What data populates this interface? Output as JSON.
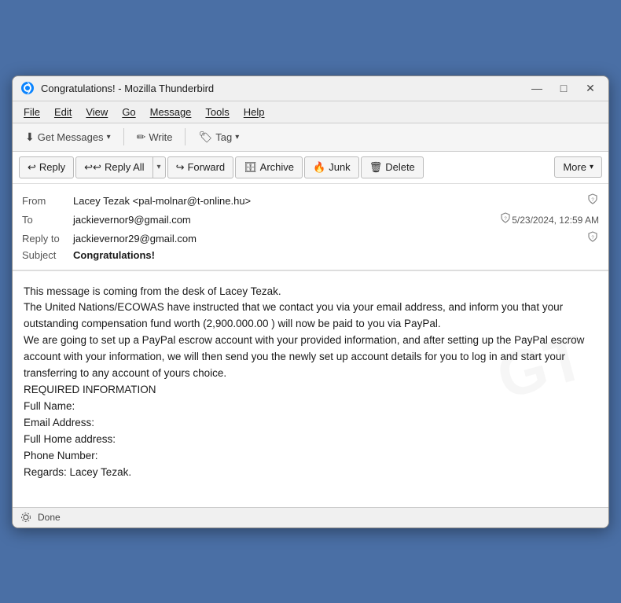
{
  "window": {
    "title": "Congratulations! - Mozilla Thunderbird",
    "icon": "thunderbird"
  },
  "title_controls": {
    "minimize": "—",
    "maximize": "□",
    "close": "✕"
  },
  "menu": {
    "items": [
      "File",
      "Edit",
      "View",
      "Go",
      "Message",
      "Tools",
      "Help"
    ]
  },
  "toolbar": {
    "get_messages": "Get Messages",
    "write": "Write",
    "tag": "Tag"
  },
  "actions": {
    "reply": "Reply",
    "reply_all": "Reply All",
    "forward": "Forward",
    "archive": "Archive",
    "junk": "Junk",
    "delete": "Delete",
    "more": "More"
  },
  "email": {
    "from_label": "From",
    "from_value": "Lacey Tezak <pal-molnar@t-online.hu>",
    "to_label": "To",
    "to_value": "jackievernor9@gmail.com",
    "date": "5/23/2024, 12:59 AM",
    "reply_to_label": "Reply to",
    "reply_to_value": "jackievernor29@gmail.com",
    "subject_label": "Subject",
    "subject_value": "Congratulations!",
    "body": "This message is coming from the desk of Lacey Tezak.\nThe United Nations/ECOWAS have instructed that we contact you via your email address, and inform you that your outstanding compensation fund worth (2,900.000.00 ) will now be paid to you via PayPal.\nWe are going to set up a PayPal escrow account with your provided information, and after setting up the PayPal escrow account with your information, we will then send you the newly set up account details for you to log in and start your transferring to any account of yours choice.\nREQUIRED INFORMATION\nFull Name:\nEmail Address:\nFull Home address:\nPhone Number:\nRegards: Lacey Tezak."
  },
  "status": {
    "text": "Done",
    "icon": "radio-waves"
  }
}
